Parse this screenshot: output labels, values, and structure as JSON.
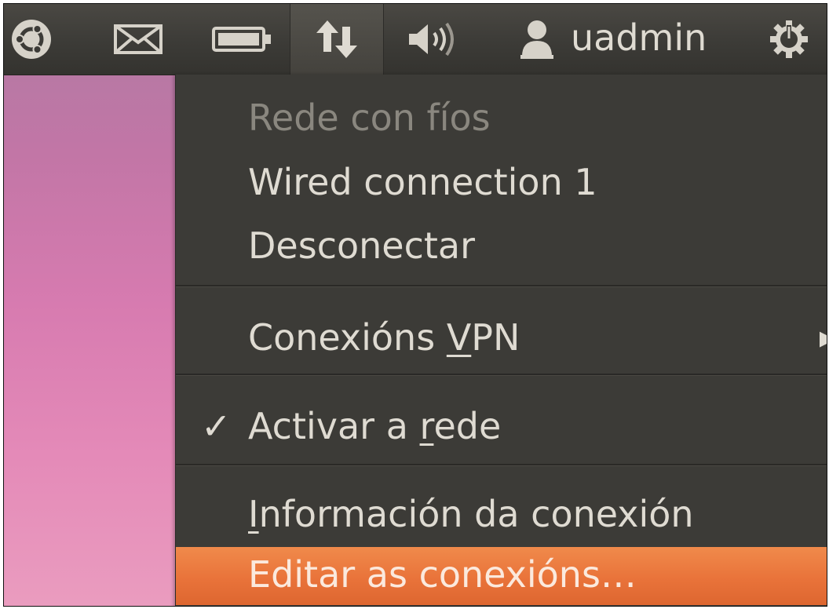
{
  "panel": {
    "username": "uadmin",
    "icons": [
      "ubuntu-logo-icon",
      "mail-icon",
      "battery-icon",
      "network-updown-icon",
      "volume-icon",
      "user-icon",
      "power-icon"
    ]
  },
  "menu": {
    "header": "Rede con fíos",
    "wired_connection": "Wired connection 1",
    "disconnect": "Desconectar",
    "vpn": {
      "before": "Conexións ",
      "mnemonic": "V",
      "after": "PN"
    },
    "enable_network": {
      "check": "✓",
      "before": "Activar a ",
      "mnemonic": "r",
      "after": "ede"
    },
    "connection_info": {
      "mnemonic": "I",
      "after": "nformación da conexión"
    },
    "edit_connections": "Editar as conexións…"
  },
  "colors": {
    "panel": "#3c3b37",
    "menu": "#3c3b37",
    "highlight": "#e9733a",
    "text": "#dfdbd2",
    "disabled_text": "#8a877f"
  }
}
